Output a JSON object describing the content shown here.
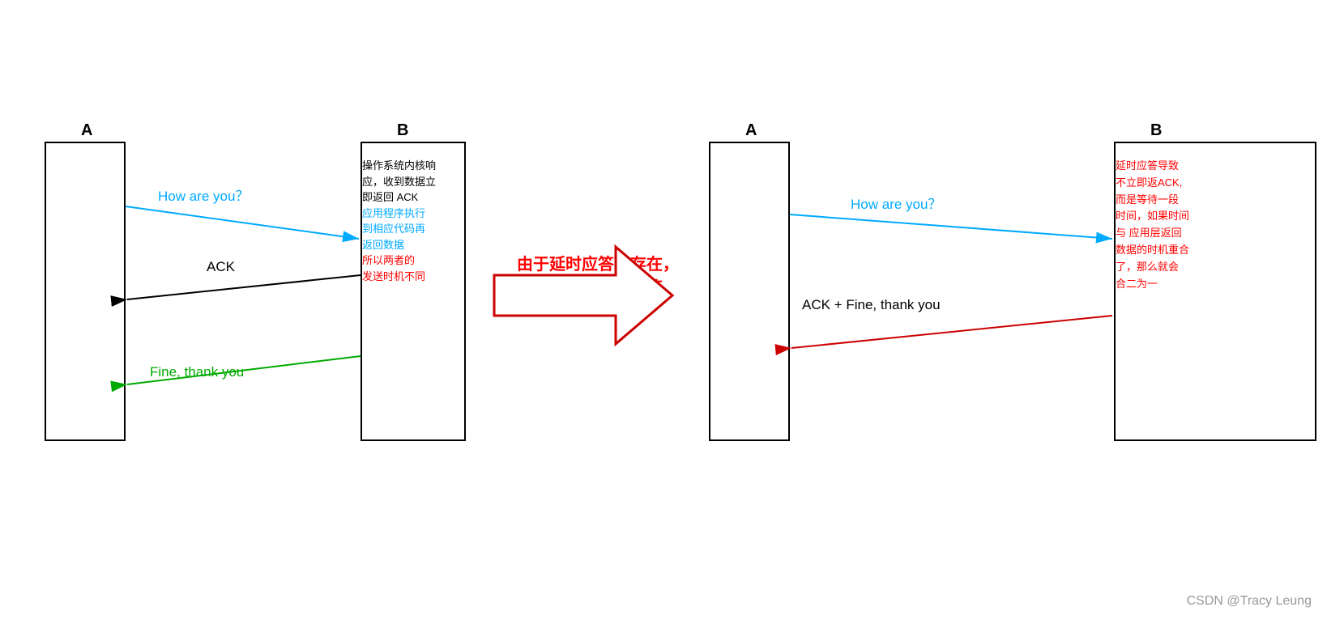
{
  "left_diagram": {
    "label_a": "A",
    "label_b": "B",
    "how_are_you": "How are you？",
    "ack_label": "ACK",
    "fine_label": "Fine, thank you",
    "b_content": {
      "line1": "操作系统内核响",
      "line2": "应，收到数据立",
      "line3": "即返回 ACK",
      "line4": "应用程序执行",
      "line5": "到相应代码再",
      "line6": "返回数据",
      "line7": "所以两者的",
      "line8": "发送时机不同"
    }
  },
  "right_diagram": {
    "label_a": "A",
    "label_b": "B",
    "how_are_you": "How are you？",
    "ack_fine_label": "ACK + Fine, thank you",
    "b_content": {
      "line1": "延时应答导致",
      "line2": "不立即返ACK,",
      "line3": "而是等待一段",
      "line4": "时间，如果时间",
      "line5": "与 应用层返回",
      "line6": "数据的时机重合",
      "line7": "了，那么就会",
      "line8": "合二为一"
    }
  },
  "middle": {
    "arrow_text_line1": "由于延时应答的存在，",
    "arrow_text_line2": "就会引发捎带应答"
  },
  "watermark": "CSDN @Tracy Leung"
}
